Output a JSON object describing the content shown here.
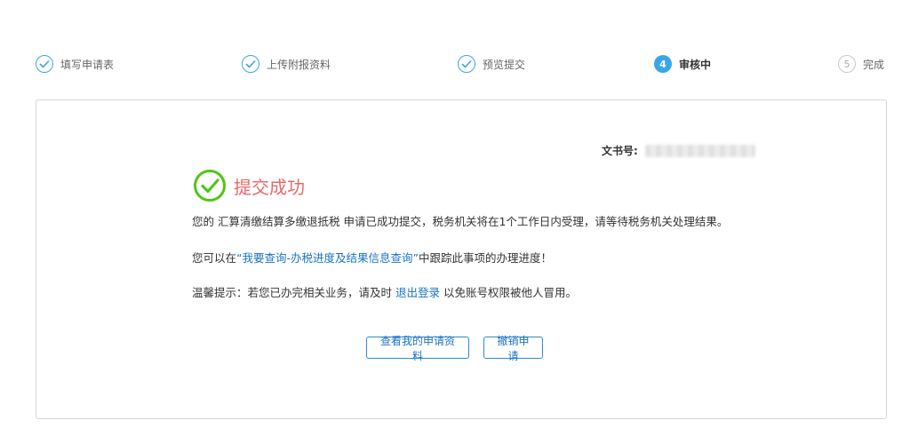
{
  "stepper": {
    "steps": [
      {
        "label": "填写申请表",
        "status": "done"
      },
      {
        "label": "上传附报资料",
        "status": "done"
      },
      {
        "label": "预览提交",
        "status": "done"
      },
      {
        "label": "审核中",
        "status": "current",
        "number": "4"
      },
      {
        "label": "完成",
        "status": "pending",
        "number": "5"
      }
    ]
  },
  "result": {
    "doc_number_label": "文书号:",
    "title": "提交成功",
    "message_1": "您的 汇算清缴结算多缴退抵税 申请已成功提交，税务机关将在1个工作日内受理，请等待税务机关处理结果。",
    "message_2": {
      "prefix": "您可以在",
      "link": "“我要查询-办税进度及结果信息查询”",
      "suffix": "中跟踪此事项的办理进度！"
    },
    "message_3": {
      "prefix": "温馨提示：若您已办完相关业务，请及时 ",
      "link": "退出登录",
      "suffix": " 以免账号权限被他人冒用。"
    }
  },
  "actions": {
    "view_label": "查看我的申请资料",
    "cancel_label": "撤销申请"
  },
  "colors": {
    "accent": "#3aa6e8",
    "success": "#52c41a",
    "title": "#e8696b",
    "link": "#1a73c2"
  }
}
